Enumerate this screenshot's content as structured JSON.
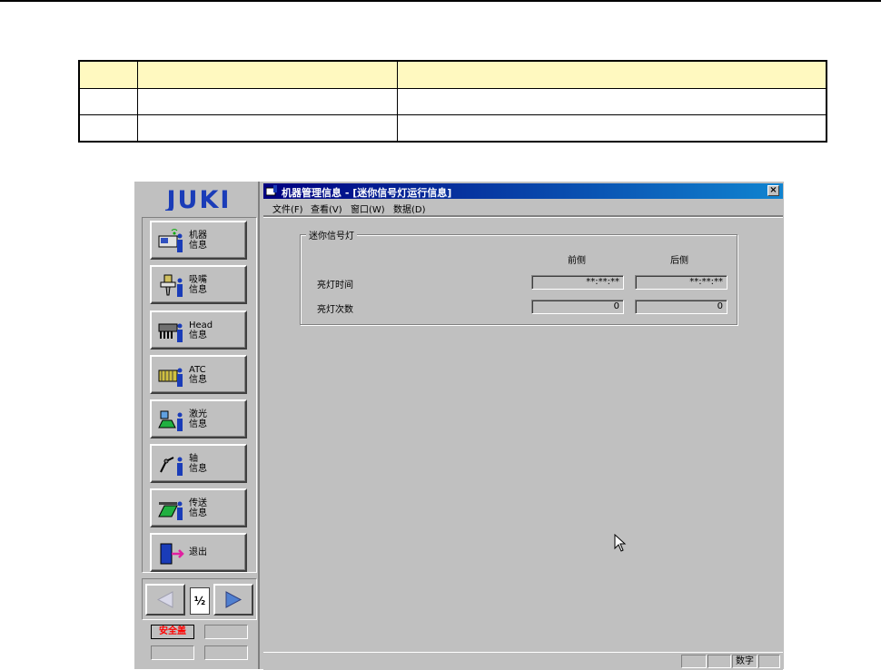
{
  "document": {
    "table": {
      "rows": [
        [
          "",
          "",
          ""
        ],
        [
          "",
          "",
          ""
        ],
        [
          "",
          "",
          ""
        ]
      ]
    }
  },
  "app": {
    "logo_text": "JUKI",
    "nav": [
      {
        "label": "机器\n信息",
        "icon": "machine-info-icon"
      },
      {
        "label": "吸嘴\n信息",
        "icon": "nozzle-info-icon"
      },
      {
        "label": "Head\n信息",
        "icon": "head-info-icon"
      },
      {
        "label": "ATC\n信息",
        "icon": "atc-info-icon"
      },
      {
        "label": "激光\n信息",
        "icon": "laser-info-icon"
      },
      {
        "label": "轴\n信息",
        "icon": "axis-info-icon"
      },
      {
        "label": "传送\n信息",
        "icon": "conveyor-info-icon"
      },
      {
        "label": "退出",
        "icon": "exit-door-icon"
      }
    ],
    "pager": {
      "indicator": "½"
    },
    "safety_label": "安全盖",
    "colors": {
      "title_start": "#000080",
      "title_end": "#1084d0",
      "panel": "#c0c0c0",
      "header_row": "#fff9c0",
      "safety": "#ff0000"
    }
  },
  "window": {
    "title": "机器管理信息 - [迷你信号灯运行信息]",
    "close_label": "×",
    "menu": [
      "文件(F)",
      "查看(V)",
      "窗口(W)",
      "数据(D)"
    ]
  },
  "panel": {
    "group_title": "迷你信号灯",
    "col_front": "前侧",
    "col_rear": "后侧",
    "rows": [
      {
        "label": "亮灯时间",
        "front": "**:**:**",
        "rear": "**:**:**"
      },
      {
        "label": "亮灯次数",
        "front": "0",
        "rear": "0"
      }
    ]
  },
  "statusbar": {
    "num": "数字"
  }
}
